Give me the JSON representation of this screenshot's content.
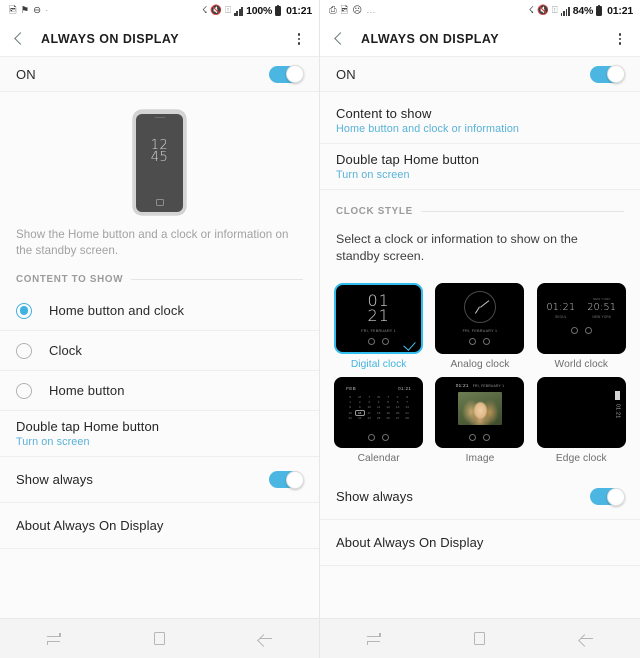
{
  "left": {
    "status_bar": {
      "left_icons": [
        "image-icon",
        "flag-icon",
        "do-not-disturb-icon",
        "more-dot-icon"
      ],
      "bluetooth_icon": "bluetooth-icon",
      "mute_icon": "mute-icon",
      "wifi_icon": "wifi-icon",
      "signal_icon": "signal-icon",
      "battery_percent": "100%",
      "time": "01:21"
    },
    "app_bar": {
      "title": "ALWAYS ON DISPLAY",
      "back": "back-icon",
      "menu": "more-options-icon"
    },
    "on_row": {
      "label": "ON",
      "toggle_state": "on"
    },
    "preview": {
      "clock_line1": "12",
      "clock_line2": "45"
    },
    "description": "Show the Home button and a clock or information on the standby screen.",
    "content_section": {
      "header": "CONTENT TO SHOW"
    },
    "options": [
      {
        "label": "Home button and clock",
        "selected": true
      },
      {
        "label": "Clock",
        "selected": false
      },
      {
        "label": "Home button",
        "selected": false
      }
    ],
    "double_tap": {
      "title": "Double tap Home button",
      "subtitle": "Turn on screen"
    },
    "show_always": {
      "title": "Show always",
      "toggle_state": "on"
    },
    "about": {
      "title": "About Always On Display"
    },
    "nav": {
      "recents": "recents-icon",
      "home": "home-icon",
      "back": "back-icon"
    }
  },
  "right": {
    "status_bar": {
      "left_icons": [
        "screenshot-icon",
        "image-icon",
        "emoji-icon",
        "more-dot-icon"
      ],
      "bluetooth_icon": "bluetooth-icon",
      "mute_icon": "mute-icon",
      "wifi_icon": "wifi-icon",
      "signal_icon": "signal-icon",
      "battery_percent": "84%",
      "time": "01:21"
    },
    "app_bar": {
      "title": "ALWAYS ON DISPLAY",
      "back": "back-icon",
      "menu": "more-options-icon"
    },
    "on_row": {
      "label": "ON",
      "toggle_state": "on"
    },
    "content_to_show": {
      "title": "Content to show",
      "subtitle": "Home button and clock or information"
    },
    "double_tap": {
      "title": "Double tap Home button",
      "subtitle": "Turn on screen"
    },
    "clock_section": {
      "header": "CLOCK STYLE",
      "description": "Select a clock or information to show on the standby screen."
    },
    "clock_styles": [
      {
        "label": "Digital clock",
        "selected": true,
        "time": "01",
        "time2": "21",
        "date": "FRI, FEBRUARY 1"
      },
      {
        "label": "Analog clock",
        "selected": false,
        "date": "FRI, FEBRUARY 1"
      },
      {
        "label": "World clock",
        "selected": false,
        "time_local": "01:21",
        "time_world": "20:51",
        "label_local": "SEOUL",
        "label_world": "NEW YORK"
      },
      {
        "label": "Calendar",
        "selected": false,
        "month": "FEB",
        "time": "01:21"
      },
      {
        "label": "Image",
        "selected": false,
        "time": "01:21",
        "date": "FRI, FEBRUARY 1"
      },
      {
        "label": "Edge clock",
        "selected": false,
        "time": "01:21"
      }
    ],
    "show_always": {
      "title": "Show always",
      "toggle_state": "on"
    },
    "about": {
      "title": "About Always On Display"
    },
    "nav": {
      "recents": "recents-icon",
      "home": "home-icon",
      "back": "back-icon"
    }
  }
}
